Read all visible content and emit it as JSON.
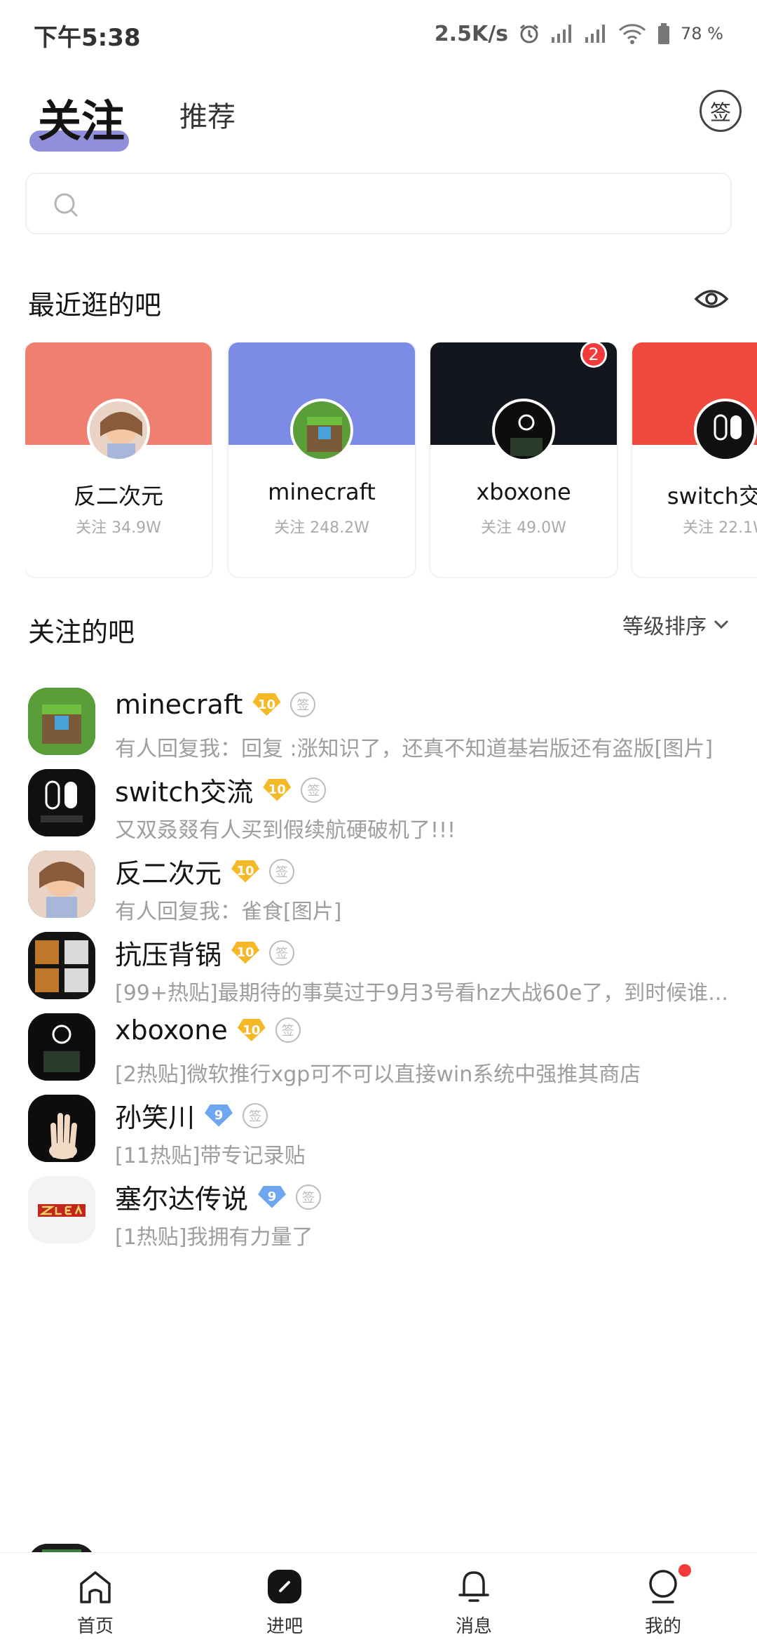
{
  "status_bar": {
    "time": "下午5:38",
    "speed": "2.5K/s",
    "battery": "78 %"
  },
  "top_tabs": {
    "active": "关注",
    "other": "推荐",
    "sign_label": "签"
  },
  "search": {
    "placeholder": ""
  },
  "recent": {
    "title": "最近逛的吧",
    "cards": [
      {
        "name": "反二次元",
        "followers": "关注 34.9W",
        "banner_color": "#ef7f6e"
      },
      {
        "name": "minecraft",
        "followers": "关注 248.2W",
        "banner_color": "#7b8be6"
      },
      {
        "name": "xboxone",
        "followers": "关注 49.0W",
        "banner_color": "#14161e",
        "badge": "2"
      },
      {
        "name": "switch交流",
        "followers": "关注 22.1W",
        "banner_color": "#f04a3e"
      }
    ]
  },
  "followed": {
    "title": "关注的吧",
    "sort_label": "等级排序",
    "items": [
      {
        "name": "minecraft",
        "level": "10",
        "level_type": "gold",
        "sub": "有人回复我：回复 :涨知识了，还真不知道基岩版还有盗版[图片]"
      },
      {
        "name": "switch交流",
        "level": "10",
        "level_type": "gold",
        "sub": "又双叒叕有人买到假续航硬破机了!!!"
      },
      {
        "name": "反二次元",
        "level": "10",
        "level_type": "gold",
        "sub": "有人回复我：雀食[图片]"
      },
      {
        "name": "抗压背锅",
        "level": "10",
        "level_type": "gold",
        "sub": "[99+热贴]最期待的事莫过于9月3号看hz大战60e了，到时候谁..."
      },
      {
        "name": "xboxone",
        "level": "10",
        "level_type": "gold",
        "sub": "[2热贴]微软推行xgp可不可以直接win系统中强推其商店"
      },
      {
        "name": "孙笑川",
        "level": "9",
        "level_type": "blue",
        "sub": "[11热贴]带专记录贴"
      },
      {
        "name": "塞尔达传说",
        "level": "9",
        "level_type": "blue",
        "sub": "[1热贴]我拥有力量了"
      }
    ]
  },
  "bottom_nav": {
    "home": "首页",
    "enter": "进吧",
    "messages": "消息",
    "mine": "我的"
  },
  "colors": {
    "accent_underline": "#8f8fdc",
    "gold_badge": "#f5b827",
    "blue_badge": "#6ea7f0",
    "notification_red": "#f33b3b"
  }
}
